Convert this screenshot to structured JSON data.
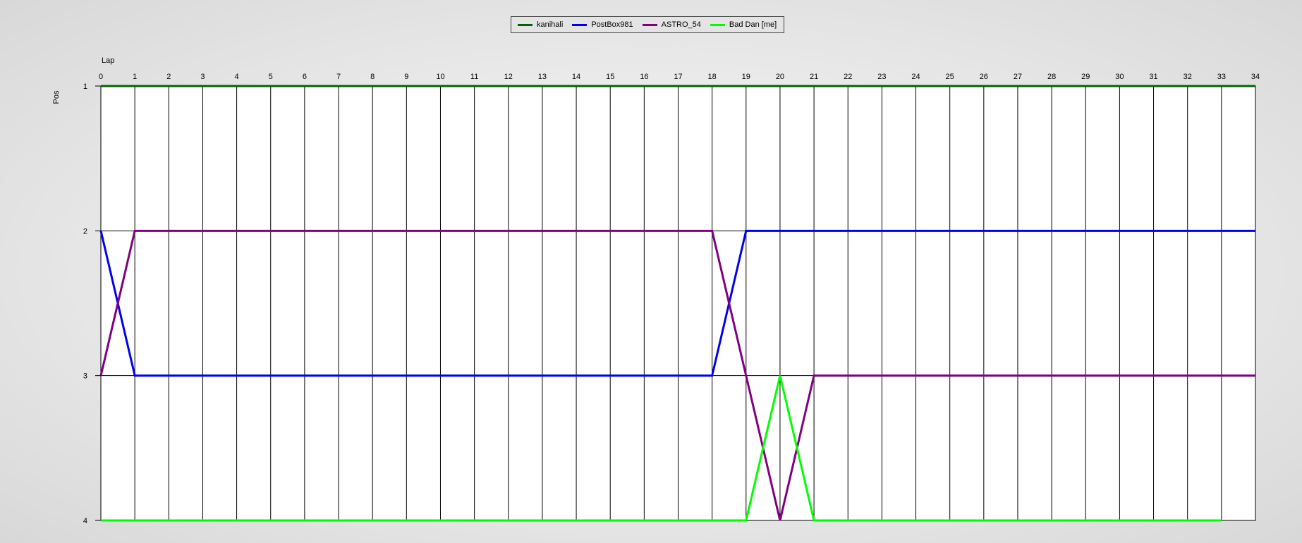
{
  "chart_data": {
    "type": "line",
    "xlabel": "Lap",
    "ylabel": "Pos",
    "xlim": [
      0,
      34
    ],
    "ylim": [
      1,
      4
    ],
    "y_inverted": true,
    "x_ticks": [
      0,
      1,
      2,
      3,
      4,
      5,
      6,
      7,
      8,
      9,
      10,
      11,
      12,
      13,
      14,
      15,
      16,
      17,
      18,
      19,
      20,
      21,
      22,
      23,
      24,
      25,
      26,
      27,
      28,
      29,
      30,
      31,
      32,
      33,
      34
    ],
    "y_ticks": [
      1,
      2,
      3,
      4
    ],
    "grid": "vertical",
    "legend_position": "top-center",
    "series": [
      {
        "name": "kanihali",
        "color": "#006400",
        "x": [
          0,
          34
        ],
        "y": [
          1,
          1
        ]
      },
      {
        "name": "PostBox981",
        "color": "#0000ee",
        "x": [
          0,
          1,
          18,
          19,
          34
        ],
        "y": [
          2,
          3,
          3,
          2,
          2
        ]
      },
      {
        "name": "ASTRO_54",
        "color": "#800080",
        "x": [
          0,
          1,
          18,
          19,
          20,
          21,
          34
        ],
        "y": [
          3,
          2,
          2,
          3,
          4,
          3,
          3
        ]
      },
      {
        "name": "Bad Dan [me]",
        "color": "#00ff00",
        "x": [
          0,
          19,
          20,
          21,
          33
        ],
        "y": [
          4,
          4,
          3,
          4,
          4
        ]
      }
    ]
  }
}
